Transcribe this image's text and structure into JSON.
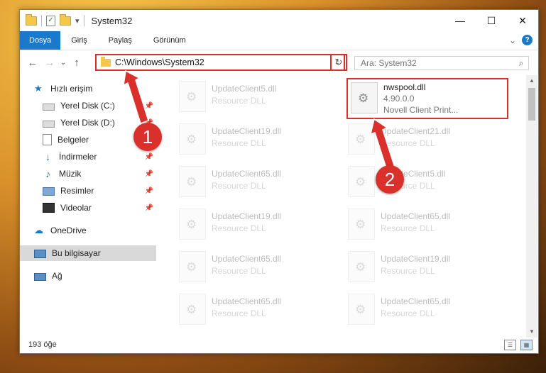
{
  "window": {
    "title": "System32",
    "controls": {
      "minimize": "—",
      "maximize": "☐",
      "close": "✕"
    }
  },
  "ribbon": {
    "tabs": [
      "Dosya",
      "Giriş",
      "Paylaş",
      "Görünüm"
    ],
    "expand": "⌄",
    "help": "?"
  },
  "nav_buttons": {
    "back": "←",
    "forward": "→",
    "recent": "⌄",
    "up": "↑"
  },
  "address": {
    "path": "C:\\Windows\\System32",
    "dropdown": "⌄",
    "refresh": "↻"
  },
  "search": {
    "placeholder": "Ara: System32",
    "icon": "⌕"
  },
  "sidebar": {
    "items": [
      {
        "label": "Hızlı erişim",
        "icon": "star-icon"
      },
      {
        "label": "Yerel Disk (C:)",
        "icon": "drive-icon",
        "pinned": true
      },
      {
        "label": "Yerel Disk (D:)",
        "icon": "drive-icon",
        "pinned": true
      },
      {
        "label": "Belgeler",
        "icon": "documents-icon",
        "pinned": true
      },
      {
        "label": "İndirmeler",
        "icon": "download-icon",
        "pinned": true
      },
      {
        "label": "Müzik",
        "icon": "music-icon",
        "pinned": true
      },
      {
        "label": "Resimler",
        "icon": "pictures-icon",
        "pinned": true
      },
      {
        "label": "Videolar",
        "icon": "video-icon",
        "pinned": true
      },
      {
        "label": "OneDrive",
        "icon": "cloud-icon"
      },
      {
        "label": "Bu bilgisayar",
        "icon": "computer-icon",
        "selected": true
      },
      {
        "label": "Ağ",
        "icon": "network-icon"
      }
    ],
    "pin_glyph": "📌"
  },
  "files": [
    {
      "name": "UpdateClient5.dll",
      "sub": "Resource DLL",
      "faded": true
    },
    {
      "name": "nwspool.dll",
      "sub": "4.90.0.0",
      "sub2": "Novell Client Print...",
      "highlight": true
    },
    {
      "name": "UpdateClient19.dll",
      "sub": "Resource DLL",
      "faded": true
    },
    {
      "name": "UpdateClient21.dll",
      "sub": "Resource DLL",
      "faded": true
    },
    {
      "name": "UpdateClient65.dll",
      "sub": "Resource DLL",
      "faded": true
    },
    {
      "name": "UpdateClient5.dll",
      "sub": "Resource DLL",
      "faded": true
    },
    {
      "name": "UpdateClient19.dll",
      "sub": "Resource DLL",
      "faded": true
    },
    {
      "name": "UpdateClient65.dll",
      "sub": "Resource DLL",
      "faded": true
    },
    {
      "name": "UpdateClient65.dll",
      "sub": "Resource DLL",
      "faded": true
    },
    {
      "name": "UpdateClient19.dll",
      "sub": "Resource DLL",
      "faded": true
    },
    {
      "name": "UpdateClient65.dll",
      "sub": "Resource DLL",
      "faded": true
    },
    {
      "name": "UpdateClient65.dll",
      "sub": "Resource DLL",
      "faded": true
    }
  ],
  "status": {
    "count": "193 öğe"
  },
  "annotations": {
    "callout1": "1",
    "callout2": "2",
    "color": "#d9302c"
  }
}
